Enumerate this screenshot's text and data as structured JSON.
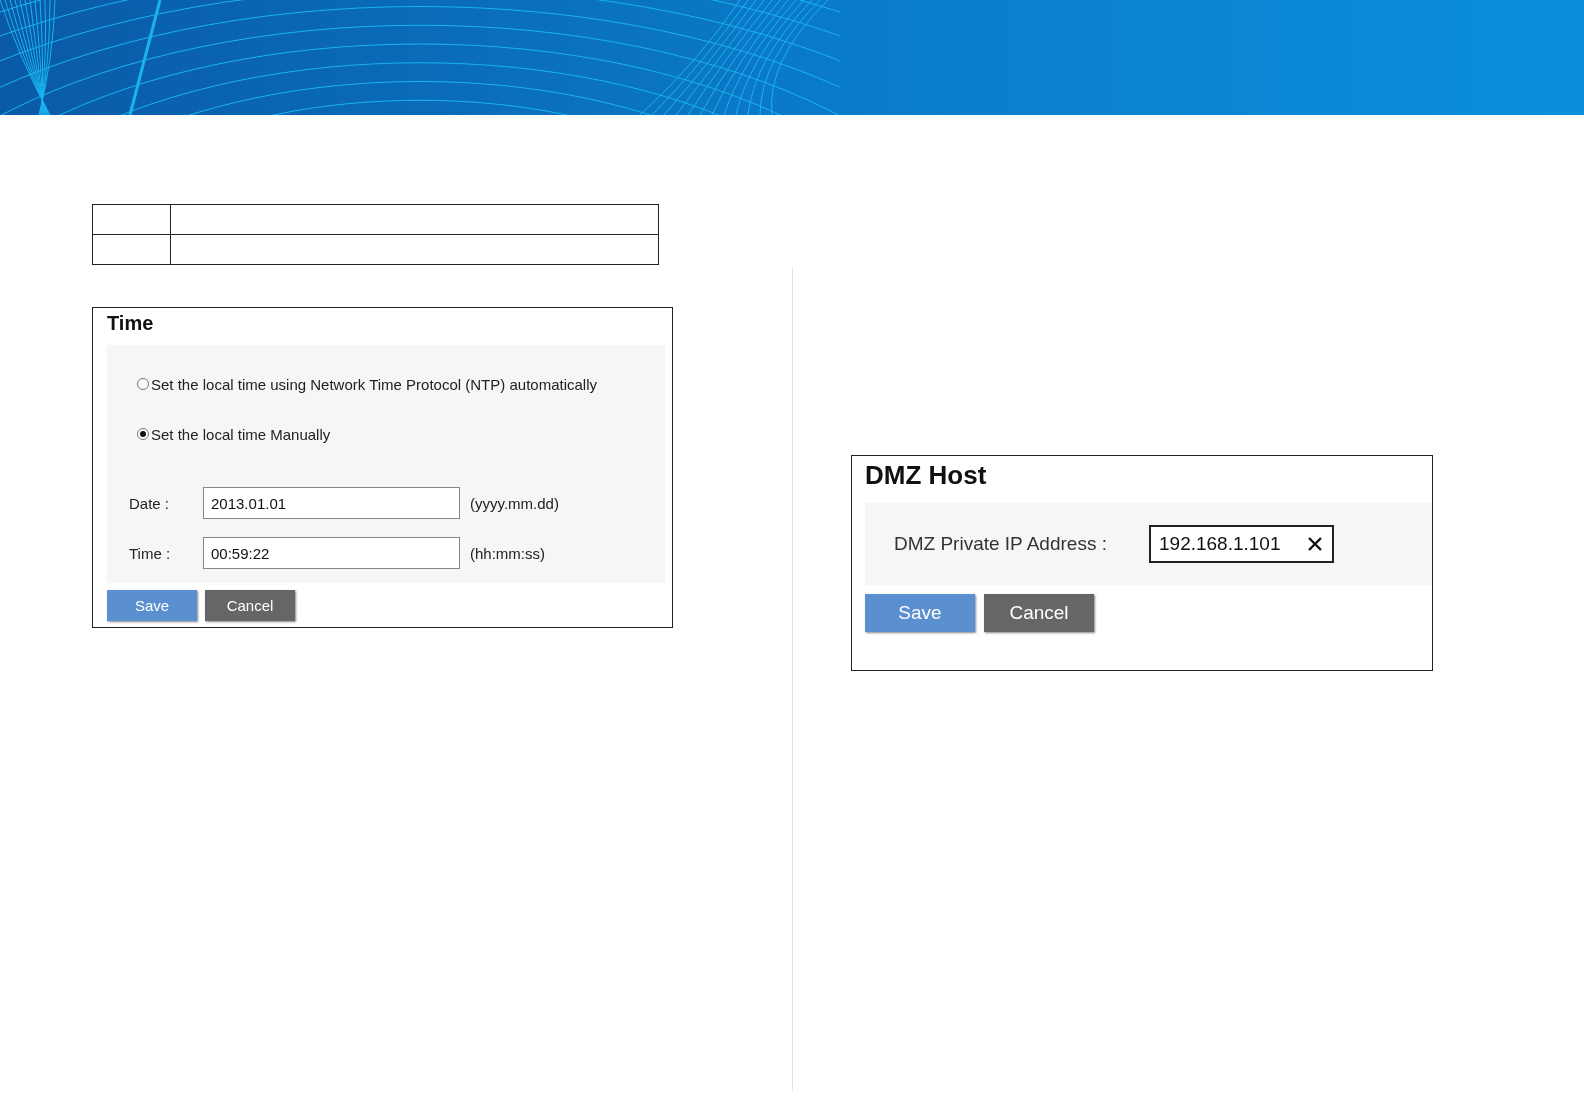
{
  "time_panel": {
    "title": "Time",
    "options": [
      {
        "label": "Set the local time using Network Time Protocol (NTP) automatically",
        "selected": false
      },
      {
        "label": "Set the local time Manually",
        "selected": true
      }
    ],
    "fields": [
      {
        "label": "Date :",
        "value": "2013.01.01",
        "hint": "(yyyy.mm.dd)"
      },
      {
        "label": "Time :",
        "value": "00:59:22",
        "hint": "(hh:mm:ss)"
      }
    ],
    "buttons": [
      {
        "label": "Save",
        "kind": "primary"
      },
      {
        "label": "Cancel",
        "kind": "secondary"
      }
    ]
  },
  "dmz_panel": {
    "title": "DMZ Host",
    "field": {
      "label": "DMZ Private IP Address :",
      "value": "192.168.1.101"
    },
    "buttons": [
      {
        "label": "Save",
        "kind": "primary"
      },
      {
        "label": "Cancel",
        "kind": "secondary"
      }
    ]
  }
}
